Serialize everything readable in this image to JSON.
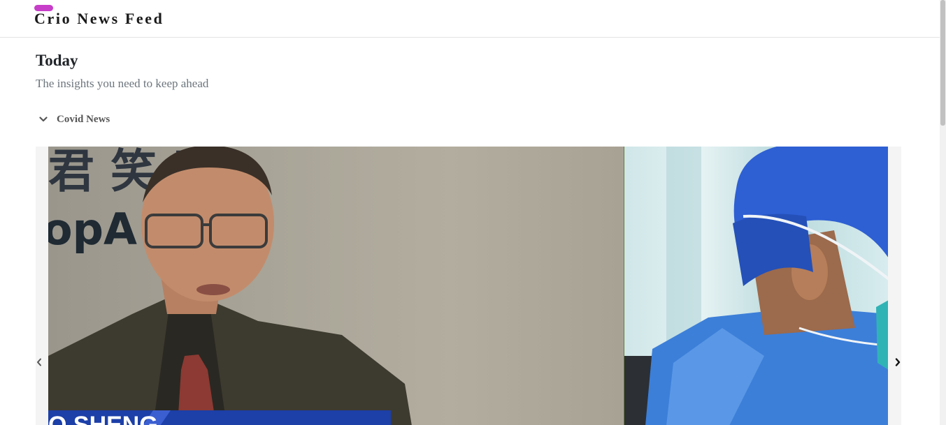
{
  "navbar": {
    "brand": "Crio News Feed",
    "brand_accent_color": "#c73ec9"
  },
  "main": {
    "title": "Today",
    "subtitle": "The insights you need to keep ahead"
  },
  "accordion": {
    "label": "Covid News",
    "expanded": true,
    "icon": "chevron-down-icon"
  },
  "carousel": {
    "caption_fragment": "O SHENG",
    "prev_icon": "chevron-left-icon",
    "next_icon": "chevron-right-icon"
  }
}
